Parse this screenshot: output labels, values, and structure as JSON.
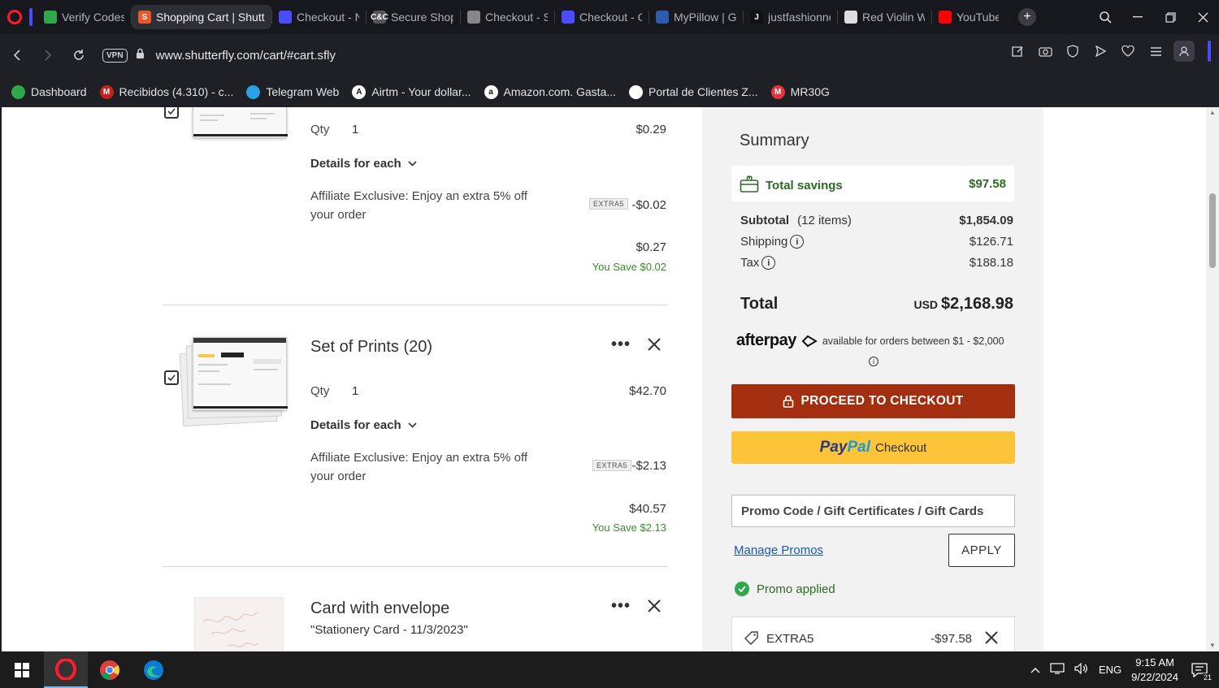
{
  "browser": {
    "tabs": [
      {
        "label": "Verify Codes -",
        "fav_color": "#2fa74a"
      },
      {
        "label": "Shopping Cart | Shutterf",
        "fav_color": "#e8592b",
        "fav_text": "S",
        "active": true
      },
      {
        "label": "Checkout - No",
        "fav_color": "#4b4bff"
      },
      {
        "label": "Secure Shopp",
        "fav_color": "#555555",
        "fav_text": "C&C"
      },
      {
        "label": "Checkout - Sti",
        "fav_color": "#888888"
      },
      {
        "label": "Checkout - Co",
        "fav_color": "#4b4bff"
      },
      {
        "label": "MyPillow | Gu",
        "fav_color": "#2a5db0"
      },
      {
        "label": "justfashionno",
        "fav_color": "#111111",
        "fav_text": "J"
      },
      {
        "label": "Red Violin Wi",
        "fav_color": "#dddddd"
      },
      {
        "label": "YouTube",
        "fav_color": "#ff0000"
      }
    ],
    "url": "www.shutterfly.com/cart/#cart.sfly",
    "vpn_label": "VPN",
    "bookmarks": [
      {
        "label": "Dashboard",
        "color": "#2fa74a"
      },
      {
        "label": "Recibidos (4.310) - c...",
        "color": "#c5221f",
        "text": "M"
      },
      {
        "label": "Telegram Web",
        "color": "#2aa1e0"
      },
      {
        "label": "Airtm - Your dollar...",
        "color": "#ffffff",
        "text": "A"
      },
      {
        "label": "Amazon.com. Gasta...",
        "color": "#ffffff",
        "text": "a"
      },
      {
        "label": "Portal de Clientes Z...",
        "color": "#ffffff"
      },
      {
        "label": "MR30G",
        "color": "#e8333c",
        "text": "M"
      }
    ]
  },
  "cart": {
    "item1": {
      "qty_label": "Qty",
      "qty": "1",
      "price": "$0.29",
      "details_label": "Details for each",
      "promo_text": "Affiliate Exclusive: Enjoy an extra 5% off your order",
      "badge": "EXTRA5",
      "discount": "-$0.02",
      "final_price": "$0.27",
      "you_save": "You Save $0.02"
    },
    "item2": {
      "title": "Set of Prints (20)",
      "qty_label": "Qty",
      "qty": "1",
      "price": "$42.70",
      "details_label": "Details for each",
      "promo_text": "Affiliate Exclusive: Enjoy an extra 5% off your order",
      "badge": "EXTRA5",
      "discount": "-$2.13",
      "final_price": "$40.57",
      "you_save": "You Save $2.13"
    },
    "item3": {
      "title": "Card with envelope",
      "subtitle": "\"Stationery Card - 11/3/2023\""
    },
    "menu_dots": "•••"
  },
  "summary": {
    "title": "Summary",
    "savings_label": "Total savings",
    "savings_value": "$97.58",
    "subtotal_label": "Subtotal",
    "subtotal_count": "(12 items)",
    "subtotal_value": "$1,854.09",
    "shipping_label": "Shipping",
    "shipping_value": "$126.71",
    "tax_label": "Tax",
    "tax_value": "$188.18",
    "total_label": "Total",
    "total_currency": "USD",
    "total_value": "$2,168.98",
    "afterpay_logo": "afterpay",
    "afterpay_note": "available for orders between $1 - $2,000",
    "checkout_label": "PROCEED TO CHECKOUT",
    "paypal_part1": "Pay",
    "paypal_part2": "Pal",
    "paypal_checkout": "Checkout",
    "promo_placeholder": "Promo Code / Gift Certificates / Gift Cards",
    "manage_promos": "Manage Promos",
    "apply_label": "APPLY",
    "promo_applied": "Promo applied",
    "applied_code": "EXTRA5",
    "applied_amount": "-$97.58"
  },
  "taskbar": {
    "tray_lang": "ENG",
    "time": "9:15 AM",
    "date": "9/22/2024",
    "notif_count": "21"
  }
}
